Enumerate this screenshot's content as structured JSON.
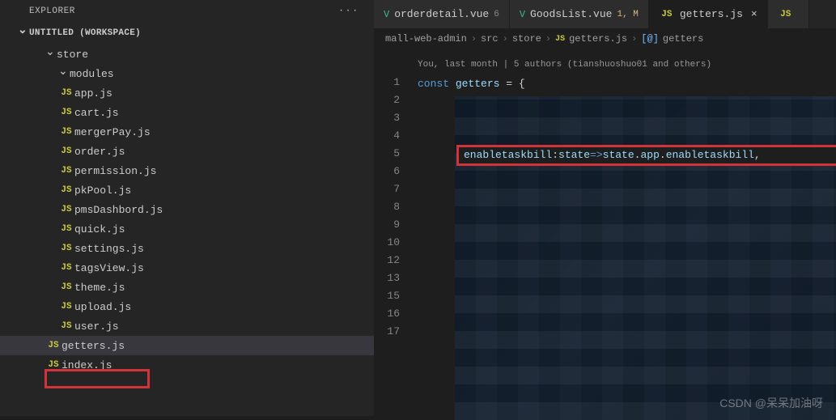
{
  "explorer": {
    "title": "EXPLORER",
    "workspace": "UNTITLED (WORKSPACE)",
    "folders": {
      "store": "store",
      "modules": "modules"
    },
    "files_l3": [
      "app.js",
      "cart.js",
      "mergerPay.js",
      "order.js",
      "permission.js",
      "pkPool.js",
      "pmsDashbord.js",
      "quick.js",
      "settings.js",
      "tagsView.js",
      "theme.js",
      "upload.js",
      "user.js"
    ],
    "files_l2": [
      "getters.js",
      "index.js"
    ]
  },
  "tabs": [
    {
      "icon": "vue",
      "label": "orderdetail.vue",
      "badge": "6",
      "active": false
    },
    {
      "icon": "vue",
      "label": "GoodsList.vue",
      "badge": "1, M",
      "active": false
    },
    {
      "icon": "js",
      "label": "getters.js",
      "badge": "",
      "active": true,
      "close": "×"
    },
    {
      "icon": "js",
      "label": "",
      "badge": "",
      "active": false
    }
  ],
  "breadcrumbs": {
    "parts": [
      "mall-web-admin",
      "src",
      "store",
      "getters.js",
      "getters"
    ]
  },
  "editor": {
    "codelens": "You, last month | 5 authors (tianshuoshuo01 and others)",
    "line_numbers": [
      "1",
      "2",
      "3",
      "4",
      "5",
      "6",
      "7",
      "8",
      "9",
      "10",
      " ",
      "12",
      "13",
      " ",
      "15",
      "16",
      "17"
    ],
    "code": {
      "line1": {
        "kw": "const",
        "var": "getters",
        "op": " = ",
        "brace": "{"
      },
      "line5": {
        "prop": "enabletaskbill",
        "colon": ": ",
        "param": "state",
        "arrow": " => ",
        "expr1": "state",
        "dot1": ".",
        "expr2": "app",
        "dot2": ".",
        "expr3": "enabletaskbill",
        "comma": ","
      }
    }
  },
  "watermark": "CSDN @呆呆加油呀"
}
